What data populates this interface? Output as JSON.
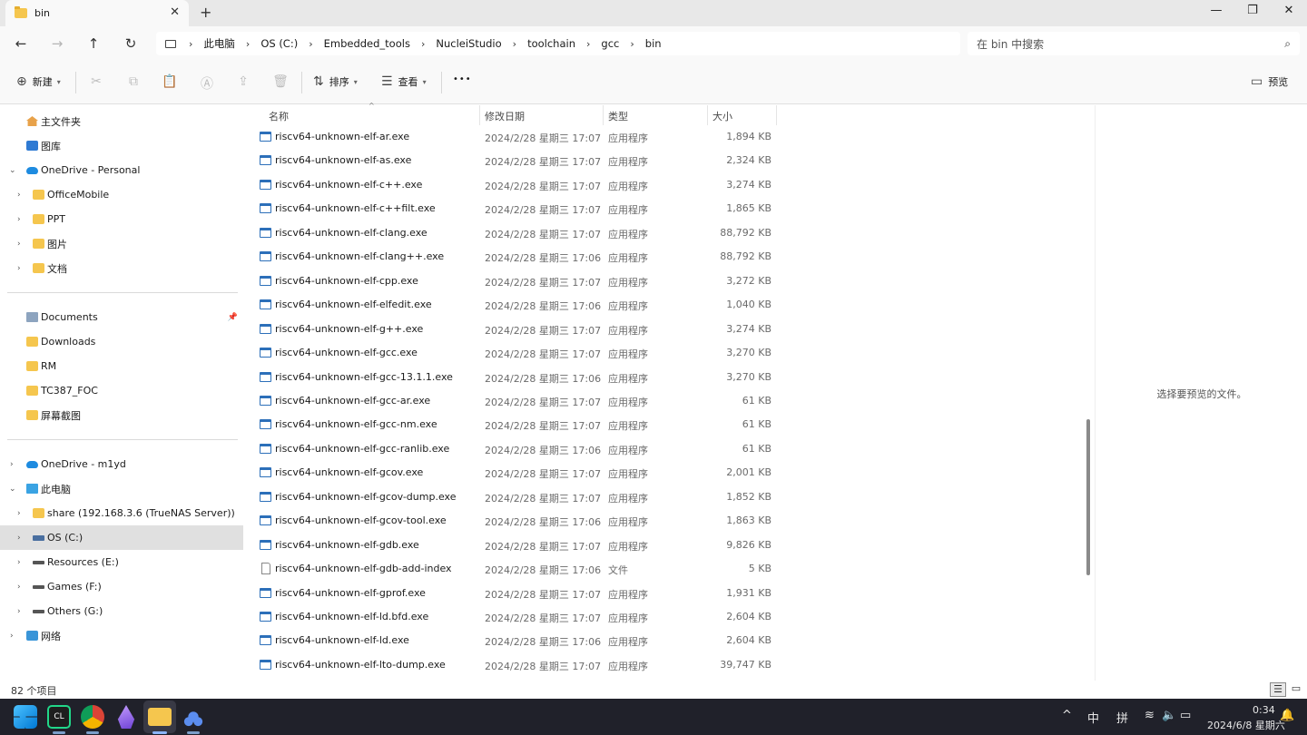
{
  "window": {
    "tab_title": "bin",
    "new_tab": "+",
    "minimize": "—",
    "maximize": "❐",
    "close": "✕"
  },
  "address": {
    "crumbs": [
      "此电脑",
      "OS (C:)",
      "Embedded_tools",
      "NucleiStudio",
      "toolchain",
      "gcc",
      "bin"
    ],
    "search_placeholder": "在 bin 中搜索"
  },
  "toolbar": {
    "new_label": "新建",
    "sort_label": "排序",
    "view_label": "查看",
    "more": "•••",
    "preview_label": "预览"
  },
  "sidebar": {
    "quick": [
      {
        "label": "主文件夹",
        "icon": "home-icon"
      },
      {
        "label": "图库",
        "icon": "gallery-icon"
      }
    ],
    "onedrive_personal": "OneDrive - Personal",
    "onedrive_children": [
      "OfficeMobile",
      "PPT",
      "图片",
      "文档"
    ],
    "pinned": [
      "Documents",
      "Downloads",
      "RM",
      "TC387_FOC",
      "屏幕截图"
    ],
    "onedrive_m1yd": "OneDrive - m1yd",
    "this_pc": "此电脑",
    "pc_children": [
      "share (192.168.3.6 (TrueNAS Server))",
      "OS (C:)",
      "Resources (E:)",
      "Games (F:)",
      "Others (G:)"
    ],
    "network": "网络"
  },
  "columns": {
    "name": "名称",
    "date": "修改日期",
    "type": "类型",
    "size": "大小"
  },
  "files": [
    {
      "name": "riscv64-unknown-elf-ar.exe",
      "date": "2024/2/28 星期三 17:07",
      "type": "应用程序",
      "size": "1,894 KB",
      "exe": true
    },
    {
      "name": "riscv64-unknown-elf-as.exe",
      "date": "2024/2/28 星期三 17:07",
      "type": "应用程序",
      "size": "2,324 KB",
      "exe": true
    },
    {
      "name": "riscv64-unknown-elf-c++.exe",
      "date": "2024/2/28 星期三 17:07",
      "type": "应用程序",
      "size": "3,274 KB",
      "exe": true
    },
    {
      "name": "riscv64-unknown-elf-c++filt.exe",
      "date": "2024/2/28 星期三 17:07",
      "type": "应用程序",
      "size": "1,865 KB",
      "exe": true
    },
    {
      "name": "riscv64-unknown-elf-clang.exe",
      "date": "2024/2/28 星期三 17:07",
      "type": "应用程序",
      "size": "88,792 KB",
      "exe": true
    },
    {
      "name": "riscv64-unknown-elf-clang++.exe",
      "date": "2024/2/28 星期三 17:06",
      "type": "应用程序",
      "size": "88,792 KB",
      "exe": true
    },
    {
      "name": "riscv64-unknown-elf-cpp.exe",
      "date": "2024/2/28 星期三 17:07",
      "type": "应用程序",
      "size": "3,272 KB",
      "exe": true
    },
    {
      "name": "riscv64-unknown-elf-elfedit.exe",
      "date": "2024/2/28 星期三 17:06",
      "type": "应用程序",
      "size": "1,040 KB",
      "exe": true
    },
    {
      "name": "riscv64-unknown-elf-g++.exe",
      "date": "2024/2/28 星期三 17:07",
      "type": "应用程序",
      "size": "3,274 KB",
      "exe": true
    },
    {
      "name": "riscv64-unknown-elf-gcc.exe",
      "date": "2024/2/28 星期三 17:07",
      "type": "应用程序",
      "size": "3,270 KB",
      "exe": true
    },
    {
      "name": "riscv64-unknown-elf-gcc-13.1.1.exe",
      "date": "2024/2/28 星期三 17:06",
      "type": "应用程序",
      "size": "3,270 KB",
      "exe": true
    },
    {
      "name": "riscv64-unknown-elf-gcc-ar.exe",
      "date": "2024/2/28 星期三 17:07",
      "type": "应用程序",
      "size": "61 KB",
      "exe": true
    },
    {
      "name": "riscv64-unknown-elf-gcc-nm.exe",
      "date": "2024/2/28 星期三 17:07",
      "type": "应用程序",
      "size": "61 KB",
      "exe": true
    },
    {
      "name": "riscv64-unknown-elf-gcc-ranlib.exe",
      "date": "2024/2/28 星期三 17:06",
      "type": "应用程序",
      "size": "61 KB",
      "exe": true
    },
    {
      "name": "riscv64-unknown-elf-gcov.exe",
      "date": "2024/2/28 星期三 17:07",
      "type": "应用程序",
      "size": "2,001 KB",
      "exe": true
    },
    {
      "name": "riscv64-unknown-elf-gcov-dump.exe",
      "date": "2024/2/28 星期三 17:07",
      "type": "应用程序",
      "size": "1,852 KB",
      "exe": true
    },
    {
      "name": "riscv64-unknown-elf-gcov-tool.exe",
      "date": "2024/2/28 星期三 17:06",
      "type": "应用程序",
      "size": "1,863 KB",
      "exe": true
    },
    {
      "name": "riscv64-unknown-elf-gdb.exe",
      "date": "2024/2/28 星期三 17:07",
      "type": "应用程序",
      "size": "9,826 KB",
      "exe": true
    },
    {
      "name": "riscv64-unknown-elf-gdb-add-index",
      "date": "2024/2/28 星期三 17:06",
      "type": "文件",
      "size": "5 KB",
      "exe": false
    },
    {
      "name": "riscv64-unknown-elf-gprof.exe",
      "date": "2024/2/28 星期三 17:07",
      "type": "应用程序",
      "size": "1,931 KB",
      "exe": true
    },
    {
      "name": "riscv64-unknown-elf-ld.bfd.exe",
      "date": "2024/2/28 星期三 17:07",
      "type": "应用程序",
      "size": "2,604 KB",
      "exe": true
    },
    {
      "name": "riscv64-unknown-elf-ld.exe",
      "date": "2024/2/28 星期三 17:06",
      "type": "应用程序",
      "size": "2,604 KB",
      "exe": true
    },
    {
      "name": "riscv64-unknown-elf-lto-dump.exe",
      "date": "2024/2/28 星期三 17:07",
      "type": "应用程序",
      "size": "39,747 KB",
      "exe": true
    }
  ],
  "preview": {
    "empty_text": "选择要预览的文件。"
  },
  "status": {
    "count": "82 个项目"
  },
  "taskbar": {
    "tray_input_lang": "中",
    "tray_ime": "拼",
    "time": "0:34",
    "date": "2024/6/8 星期六"
  },
  "colors": {
    "accent": "#2c6fb9",
    "selected": "#e0e0e0",
    "taskbar": "#20212a"
  }
}
